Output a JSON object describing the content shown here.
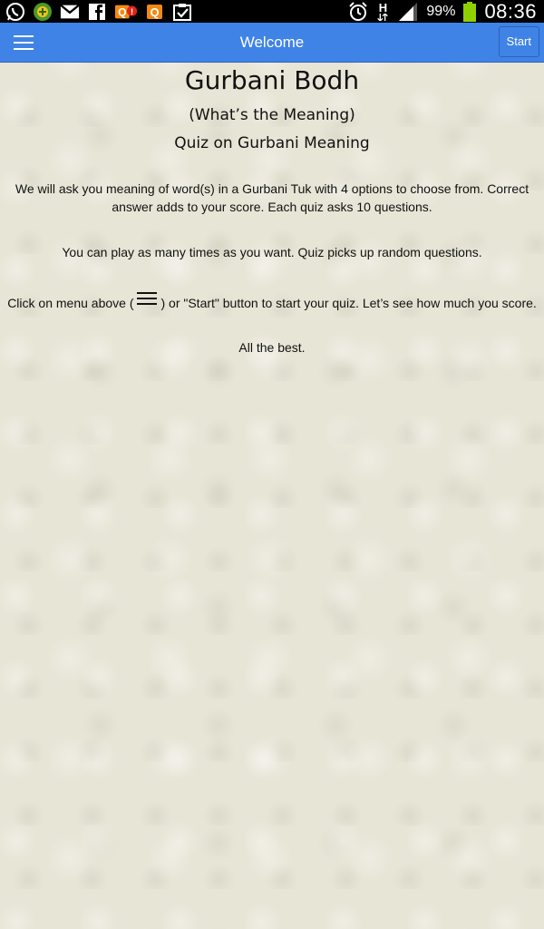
{
  "status_bar": {
    "battery_percent": "99%",
    "time": "08:36",
    "signal_type": "H",
    "icons": [
      "whatsapp-icon",
      "app-icon",
      "gmail-icon",
      "facebook-icon",
      "q-alert-icon",
      "q-icon",
      "clipboard-check-icon",
      "alarm-icon",
      "data-h-icon",
      "signal-icon",
      "battery-icon"
    ],
    "q_badge": "Q",
    "q_alert": "!",
    "q2_label": "Q",
    "battery_color": "#8ed000"
  },
  "app_bar": {
    "title": "Welcome",
    "start_label": "Start",
    "color": "#3f83e6"
  },
  "content": {
    "title": "Gurbani Bodh",
    "subtitle": "(What’s the Meaning)",
    "tagline": "Quiz on Gurbani Meaning",
    "para1": "We will ask you meaning of word(s) in a Gurbani Tuk with 4 options to choose from. Correct answer adds to your score. Each quiz asks 10 questions.",
    "para2": "You can play as many times as you want. Quiz picks up random questions.",
    "para3_before": "Click on menu above (",
    "para3_after": ") or \"Start\" button to start your quiz. Let’s see how much you score.",
    "para4": "All the best."
  }
}
